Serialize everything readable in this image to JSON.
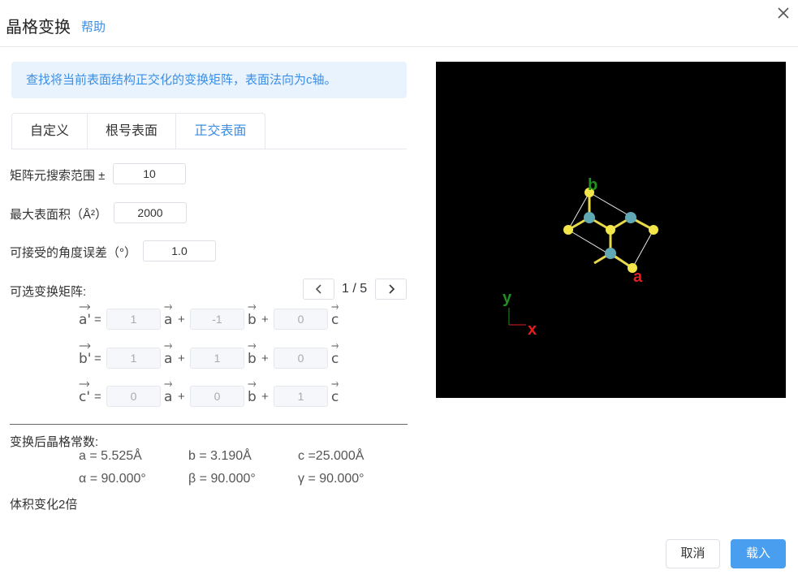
{
  "header": {
    "title": "晶格变换",
    "help": "帮助",
    "close_icon": "close-icon"
  },
  "info": "查找将当前表面结构正交化的变换矩阵，表面法向为c轴。",
  "tabs": [
    {
      "label": "自定义",
      "active": false
    },
    {
      "label": "根号表面",
      "active": false
    },
    {
      "label": "正交表面",
      "active": true
    }
  ],
  "form": {
    "range_label": "矩阵元搜索范围 ±",
    "range_value": "10",
    "area_label": "最大表面积（Å²）",
    "area_value": "2000",
    "angle_label": "可接受的角度误差（°）",
    "angle_value": "1.0"
  },
  "matrix": {
    "label": "可选变换矩阵:",
    "pager": "1 / 5",
    "rows": [
      {
        "lhs": "a'",
        "v": [
          "1",
          "-1",
          "0"
        ]
      },
      {
        "lhs": "b'",
        "v": [
          "1",
          "1",
          "0"
        ]
      },
      {
        "lhs": "c'",
        "v": [
          "0",
          "0",
          "1"
        ]
      }
    ],
    "basis": [
      "a",
      "b",
      "c"
    ],
    "eq": "=",
    "plus": "+"
  },
  "constants": {
    "label": "变换后晶格常数:",
    "a": "a = 5.525Å",
    "b": "b = 3.190Å",
    "c": "c =25.000Å",
    "alpha": "α = 90.000°",
    "beta": "β = 90.000°",
    "gamma": "γ = 90.000°"
  },
  "volume": "体积变化2倍",
  "viewer": {
    "axis_labels": {
      "a": "a",
      "b": "b",
      "x": "x",
      "y": "y"
    },
    "colors": {
      "background": "#000000",
      "atom_yellow": "#f2e64a",
      "atom_teal": "#5fa8b4",
      "a_axis": "#e02020",
      "b_axis": "#1f8f1f"
    }
  },
  "buttons": {
    "cancel": "取消",
    "load": "载入"
  },
  "colors": {
    "accent": "#3a8ee6",
    "info_bg": "#e8f3fe",
    "primary_btn": "#4a9ef0"
  }
}
